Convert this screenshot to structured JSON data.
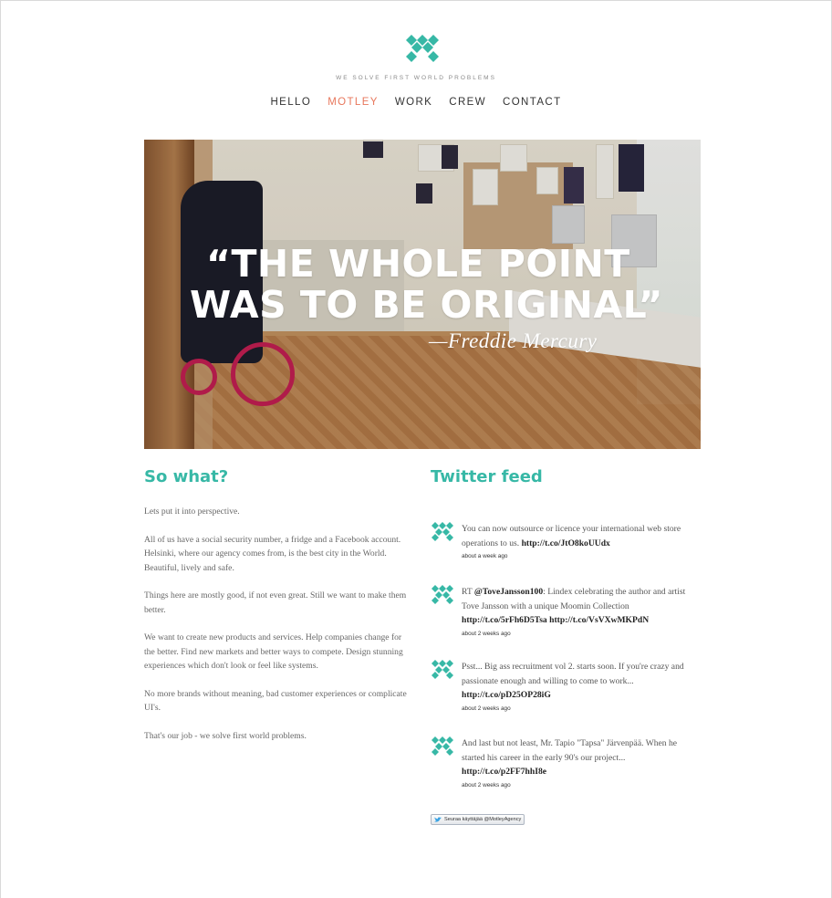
{
  "brand": {
    "logo_icon": "motley-diamond-logo-icon",
    "accent_color": "#37b8a6",
    "tagline": "WE SOLVE FIRST WORLD PROBLEMS"
  },
  "nav": {
    "items": [
      "HELLO",
      "MOTLEY",
      "WORK",
      "CREW",
      "CONTACT"
    ],
    "active": "MOTLEY",
    "active_color": "#e8775c"
  },
  "hero": {
    "quote_line1": "“THE WHOLE POINT",
    "quote_line2": "WAS TO BE ORIGINAL”",
    "author": "—Freddie Mercury"
  },
  "about": {
    "heading": "So what?",
    "paragraphs": [
      "Lets put it into perspective.",
      "All of us have a social security number, a fridge and a Facebook account. Helsinki, where our agency comes from, is the best city in the World. Beautiful, lively and safe.",
      "Things here are mostly good, if not even great. Still we want to make them better.",
      "We want to create new products and services. Help companies change for the better. Find new markets and better ways to compete. Design stunning experiences which don't look or feel like systems.",
      "No more brands without meaning, bad customer experiences or complicate UI's.",
      "That's our job - we solve first world problems."
    ]
  },
  "twitter": {
    "heading": "Twitter feed",
    "tweets": [
      {
        "text": "You can now outsource or licence your international web store operations to us. ",
        "link1": "http://t.co/JtO8koUUdx",
        "time": "about a week ago"
      },
      {
        "prefix": "RT ",
        "mention": "@ToveJansson100",
        "text": ": Lindex celebrating the author and artist Tove Jansson with a unique Moomin Collection ",
        "link1": "http://t.co/5rFh6D5Tsa",
        "link2": "http://t.co/VsVXwMKPdN",
        "time": "about 2 weeks ago"
      },
      {
        "text": "Psst... Big ass recruitment vol 2. starts soon. If you're crazy and passionate enough and willing to come to work... ",
        "link1": "http://t.co/pD25OP28iG",
        "time": "about 2 weeks ago"
      },
      {
        "text": "And last but not least, Mr. Tapio \"Tapsa\" Järvenpää. When he started his career in the early 90's our project... ",
        "link1": "http://t.co/p2FF7hhI8e",
        "time": "about 2 weeks ago"
      }
    ],
    "follow_label": "Seuraa käyttäjää @MotleyAgency"
  }
}
